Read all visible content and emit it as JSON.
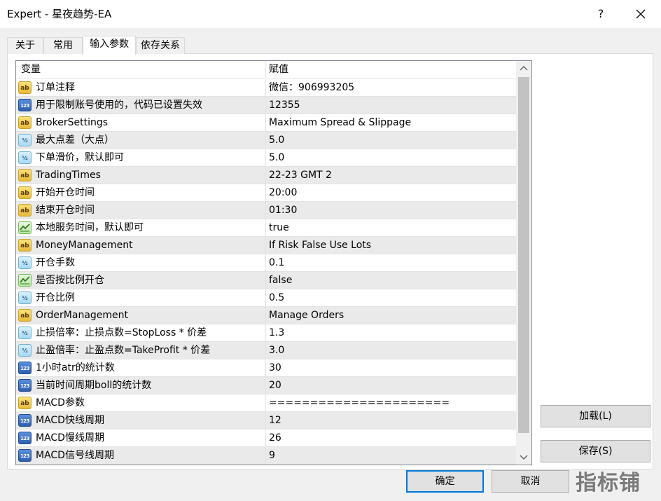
{
  "window": {
    "title": "Expert - 星夜趋势-EA",
    "help_label": "?"
  },
  "tabs": [
    {
      "label": "关于"
    },
    {
      "label": "常用"
    },
    {
      "label": "输入参数"
    },
    {
      "label": "依存关系"
    }
  ],
  "grid": {
    "col_name": "变量",
    "col_value": "赋值",
    "rows": [
      {
        "icon": "ab",
        "name": "订单注释",
        "value": "微信：906993205"
      },
      {
        "icon": "123",
        "name": "用于限制账号使用的，代码已设置失效",
        "value": "12355"
      },
      {
        "icon": "ab",
        "name": "BrokerSettings",
        "value": "Maximum Spread & Slippage"
      },
      {
        "icon": "½",
        "name": "最大点差（大点）",
        "value": "5.0"
      },
      {
        "icon": "½",
        "name": "下单滑价，默认即可",
        "value": "5.0"
      },
      {
        "icon": "ab",
        "name": "TradingTimes",
        "value": "22-23 GMT 2"
      },
      {
        "icon": "ab",
        "name": "开始开仓时间",
        "value": "20:00"
      },
      {
        "icon": "ab",
        "name": "结束开仓时间",
        "value": "01:30"
      },
      {
        "icon": "bool",
        "name": "本地服务时间，默认即可",
        "value": "true"
      },
      {
        "icon": "ab",
        "name": "MoneyManagement",
        "value": "If Risk False Use Lots"
      },
      {
        "icon": "½",
        "name": "开仓手数",
        "value": "0.1"
      },
      {
        "icon": "bool",
        "name": "是否按比例开仓",
        "value": "false"
      },
      {
        "icon": "½",
        "name": "开仓比例",
        "value": "0.5"
      },
      {
        "icon": "ab",
        "name": "OrderManagement",
        "value": "Manage Orders"
      },
      {
        "icon": "½",
        "name": "止损倍率：止损点数=StopLoss * 价差",
        "value": "1.3"
      },
      {
        "icon": "½",
        "name": "止盈倍率：止盈点数=TakeProfit * 价差",
        "value": "3.0"
      },
      {
        "icon": "123",
        "name": "1小时atr的统计数",
        "value": "30"
      },
      {
        "icon": "123",
        "name": "当前时间周期boll的统计数",
        "value": "20"
      },
      {
        "icon": "ab",
        "name": "MACD参数",
        "value": "======================"
      },
      {
        "icon": "123",
        "name": "MACD快线周期",
        "value": "12"
      },
      {
        "icon": "123",
        "name": "MACD慢线周期",
        "value": "26"
      },
      {
        "icon": "123",
        "name": "MACD信号线周期",
        "value": "9"
      }
    ]
  },
  "buttons": {
    "load": "加载(L)",
    "save": "保存(S)",
    "ok": "确定",
    "cancel": "取消"
  },
  "watermark": "指标铺"
}
